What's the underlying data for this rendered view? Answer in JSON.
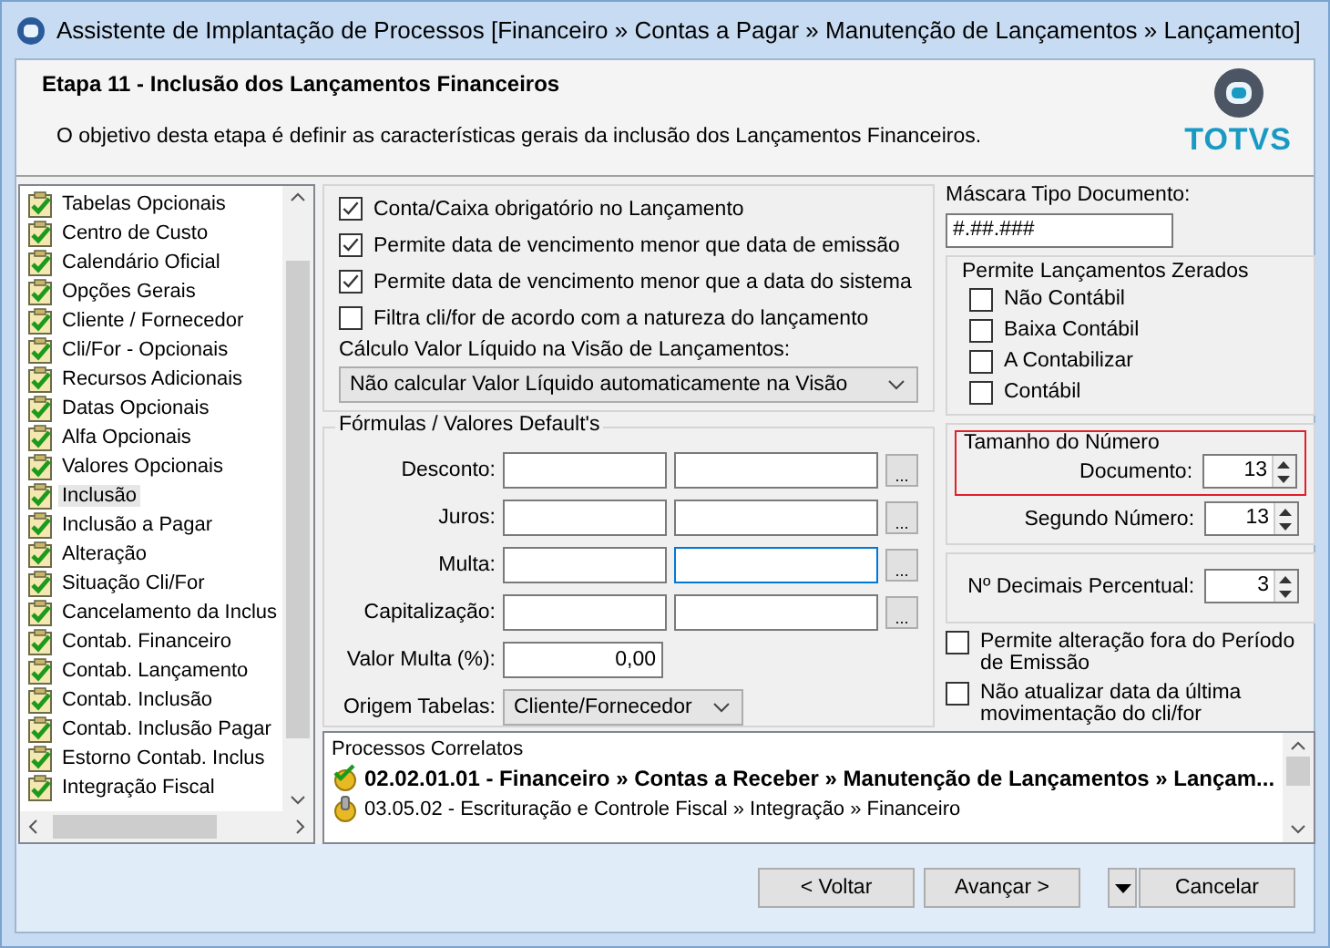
{
  "window": {
    "title": "Assistente de Implantação de Processos [Financeiro » Contas a Pagar » Manutenção de Lançamentos » Lançamento]"
  },
  "header": {
    "title": "Etapa 11 - Inclusão dos Lançamentos Financeiros",
    "description": "O objetivo desta etapa é definir as características gerais da inclusão dos Lançamentos Financeiros.",
    "logo_text": "TOTVS"
  },
  "steps": [
    {
      "label": "Tabelas Opcionais",
      "selected": false
    },
    {
      "label": "Centro de Custo",
      "selected": false
    },
    {
      "label": "Calendário Oficial",
      "selected": false
    },
    {
      "label": "Opções Gerais",
      "selected": false
    },
    {
      "label": "Cliente / Fornecedor",
      "selected": false
    },
    {
      "label": "Cli/For - Opcionais",
      "selected": false
    },
    {
      "label": "Recursos Adicionais",
      "selected": false
    },
    {
      "label": "Datas Opcionais",
      "selected": false
    },
    {
      "label": "Alfa Opcionais",
      "selected": false
    },
    {
      "label": "Valores Opcionais",
      "selected": false
    },
    {
      "label": "Inclusão",
      "selected": true
    },
    {
      "label": "Inclusão a Pagar",
      "selected": false
    },
    {
      "label": "Alteração",
      "selected": false
    },
    {
      "label": "Situação Cli/For",
      "selected": false
    },
    {
      "label": "Cancelamento da Inclus",
      "selected": false
    },
    {
      "label": "Contab. Financeiro",
      "selected": false
    },
    {
      "label": "Contab. Lançamento",
      "selected": false
    },
    {
      "label": "Contab. Inclusão",
      "selected": false
    },
    {
      "label": "Contab. Inclusão Pagar",
      "selected": false
    },
    {
      "label": "Estorno Contab. Inclus",
      "selected": false
    },
    {
      "label": "Integração Fiscal",
      "selected": false
    }
  ],
  "options": [
    {
      "label": "Conta/Caixa obrigatório no Lançamento",
      "checked": true
    },
    {
      "label": "Permite data de vencimento menor que data de emissão",
      "checked": true
    },
    {
      "label": "Permite data de vencimento menor que a data do sistema",
      "checked": true
    },
    {
      "label": "Filtra cli/for de acordo com a natureza do lançamento",
      "checked": false
    }
  ],
  "calc": {
    "label": "Cálculo Valor Líquido na Visão de Lançamentos:",
    "value": "Não calcular Valor Líquido automaticamente na Visão"
  },
  "formulas": {
    "title": "Fórmulas / Valores Default's",
    "rows": [
      {
        "label": "Desconto:",
        "focused": false,
        "button": "..."
      },
      {
        "label": "Juros:",
        "focused": false,
        "button": "..."
      },
      {
        "label": "Multa:",
        "focused": true,
        "button": "..."
      },
      {
        "label": "Capitalização:",
        "focused": false,
        "button": "..."
      }
    ],
    "valor_multa": {
      "label": "Valor Multa (%):",
      "value": "0,00"
    },
    "origem": {
      "label": "Origem Tabelas:",
      "value": "Cliente/Fornecedor"
    }
  },
  "mask": {
    "label": "Máscara Tipo Documento:",
    "value": "#.##.###"
  },
  "zero": {
    "title": "Permite Lançamentos Zerados",
    "options": [
      {
        "label": "Não Contábil",
        "checked": false
      },
      {
        "label": "Baixa Contábil",
        "checked": false
      },
      {
        "label": "A Contabilizar",
        "checked": false
      },
      {
        "label": "Contábil",
        "checked": false
      }
    ]
  },
  "size": {
    "title": "Tamanho do Número",
    "highlighted": true,
    "fields": [
      {
        "label": "Documento:",
        "value": "13"
      },
      {
        "label": "Segundo Número:",
        "value": "13"
      }
    ]
  },
  "decimals": {
    "label": "Nº Decimais Percentual:",
    "value": "3"
  },
  "flags": [
    {
      "label": "Permite alteração fora do Período de Emissão",
      "checked": false
    },
    {
      "label": "Não atualizar data da última movimentação do cli/for",
      "checked": false
    }
  ],
  "related": {
    "title": "Processos Correlatos",
    "items": [
      {
        "text": "02.02.01.01 - Financeiro » Contas a Receber » Manutenção de Lançamentos » Lançam...",
        "kind": "current"
      },
      {
        "text": "03.05.02 - Escrituração e Controle Fiscal » Integração » Financeiro",
        "kind": "other"
      }
    ]
  },
  "buttons": [
    {
      "label": "< Voltar",
      "kind": "nav"
    },
    {
      "label": "Avançar >",
      "kind": "nav"
    },
    {
      "label": "Cancelar",
      "kind": "cancel"
    }
  ]
}
